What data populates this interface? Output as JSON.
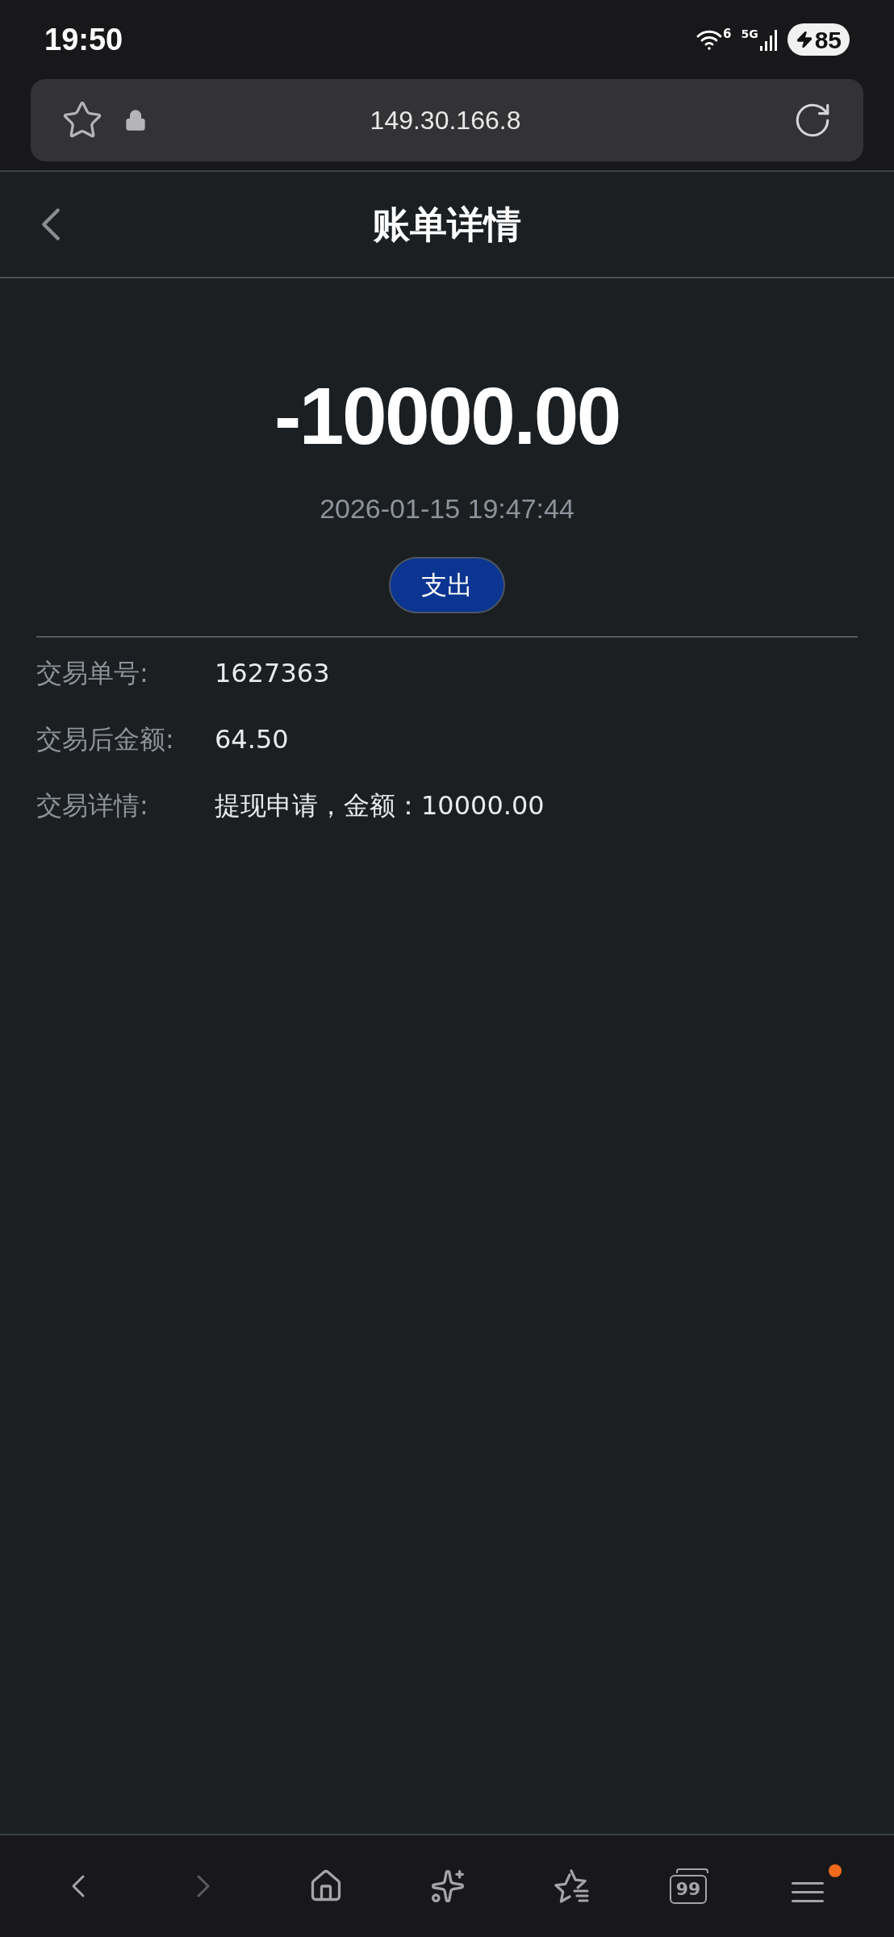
{
  "status_bar": {
    "time": "19:50",
    "wifi_badge": "6",
    "network": "5G",
    "battery": "85",
    "charging": true
  },
  "browser_bar": {
    "url": "149.30.166.8"
  },
  "header": {
    "title": "账单详情"
  },
  "summary": {
    "amount": "-10000.00",
    "time": "2026-01-15 19:47:44",
    "type_tag": "支出"
  },
  "details": [
    {
      "label": "交易单号:",
      "value": "1627363"
    },
    {
      "label": "交易后金额:",
      "value": "64.50"
    },
    {
      "label": "交易详情:",
      "value": "提现申请，金额：10000.00"
    }
  ],
  "toolbar": [
    {
      "kind": "back",
      "disabled": false
    },
    {
      "kind": "forward",
      "disabled": true
    },
    {
      "kind": "home",
      "disabled": false
    },
    {
      "kind": "assistant",
      "disabled": false
    },
    {
      "kind": "bookmarks",
      "disabled": false
    },
    {
      "kind": "tabs",
      "disabled": false,
      "count": "99"
    },
    {
      "kind": "menu",
      "disabled": false,
      "notification": true
    }
  ]
}
